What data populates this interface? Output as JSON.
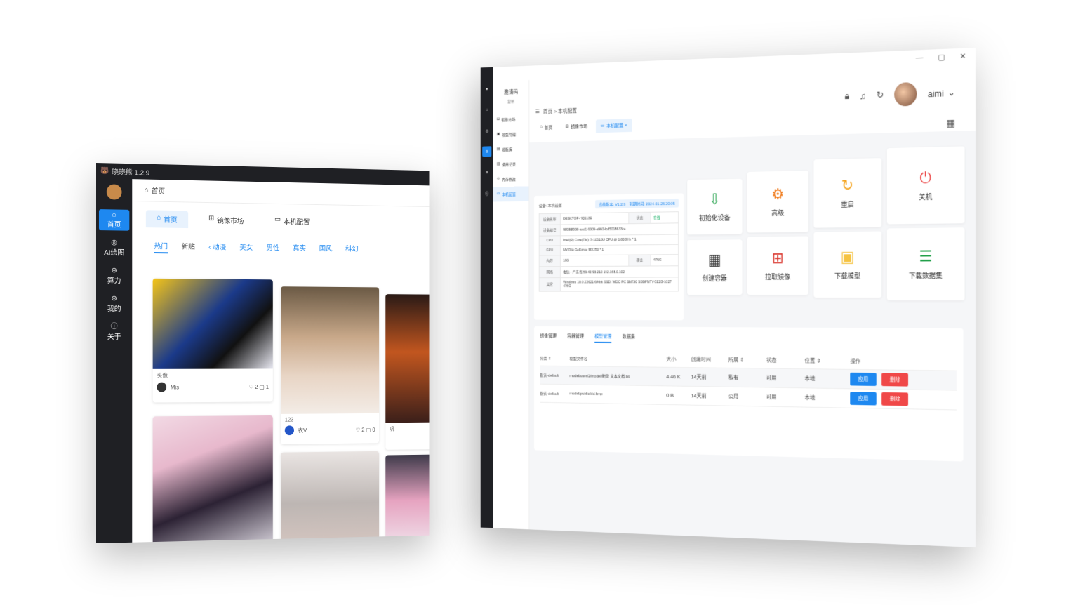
{
  "back_window": {
    "title": "晓晓熊 1.2.9",
    "nav": [
      {
        "icon": "⌂",
        "label": "首页",
        "active": true
      },
      {
        "icon": "◎",
        "label": "AI绘图"
      },
      {
        "icon": "⊕",
        "label": "算力"
      },
      {
        "icon": "⊛",
        "label": "我的"
      },
      {
        "icon": "ⓘ",
        "label": "关于"
      }
    ],
    "breadcrumb": "首页",
    "tabs": [
      {
        "icon": "⌂",
        "label": "首页",
        "active": true
      },
      {
        "icon": "⊞",
        "label": "镜像市场"
      },
      {
        "icon": "▭",
        "label": "本机配置"
      }
    ],
    "categories": [
      {
        "label": "热门",
        "state": "active"
      },
      {
        "label": "新贴"
      },
      {
        "label": "‹ 动漫",
        "state": "blue"
      },
      {
        "label": "美女",
        "state": "blue"
      },
      {
        "label": "男性",
        "state": "blue"
      },
      {
        "label": "真实",
        "state": "blue"
      },
      {
        "label": "国风",
        "state": "blue"
      },
      {
        "label": "科幻",
        "state": "blue"
      }
    ],
    "cards": [
      {
        "caption": "头像",
        "author": "Mis",
        "stats": "♡ 2  ▢ 1"
      },
      {
        "caption": "123",
        "author": "衣V",
        "stats": "♡ 2  ▢ 0"
      },
      {
        "caption": "巩",
        "author": "",
        "stats": ""
      }
    ]
  },
  "front_window": {
    "user": "aimi",
    "submenu_title": "邀请码",
    "submenu_sub": "复制",
    "submenu": [
      {
        "label": "镜像市场"
      },
      {
        "label": "模型管理"
      },
      {
        "label": "模版库"
      },
      {
        "label": "使用记录"
      },
      {
        "label": "内存修改"
      },
      {
        "label": "本机配置",
        "active": true
      }
    ],
    "breadcrumb": "首页 > 本机配置",
    "tabs": [
      {
        "label": "首页"
      },
      {
        "label": "镜像市场"
      },
      {
        "label": "本机配置 ×",
        "active": true
      }
    ],
    "device": {
      "title": "设备: 本机设置",
      "version": "当前版本: V1.2.9",
      "expire": "到期时间: 2024-01-26 20:05",
      "rows": [
        {
          "k": "设备名称",
          "v": "DESKTOP-HQ113E",
          "k2": "状态",
          "v2": "在线"
        },
        {
          "k": "设备编号",
          "v": "9898f8998-aed1-9909-a960-fcd5018633ce"
        },
        {
          "k": "CPU",
          "v": "Intel(R) Core(TM) i7-10510U CPU @ 1.80GHz * 1"
        },
        {
          "k": "GPU",
          "v": "NVIDIA GeForce MX250 * 1"
        },
        {
          "k": "内存",
          "v": "16G",
          "k2": "硬盘",
          "v2": "476G"
        },
        {
          "k": "网络",
          "v": "电信 - 广东省 59.42.93.210 192.168.0.102"
        },
        {
          "k": "其它",
          "v": "Windows 10.0.22621 64-bit  SSD: WDC PC SN730 SDBPNTY-512G-1027 476G"
        }
      ]
    },
    "actions": [
      {
        "label": "初始化设备",
        "icon": "⇩",
        "color": "#22a04a"
      },
      {
        "label": "高级",
        "icon": "⚙",
        "color": "#f07a1a"
      },
      {
        "label": "重启",
        "icon": "↻",
        "color": "#f5a623"
      },
      {
        "label": "关机",
        "icon": "⏻",
        "color": "#ea3a3a"
      },
      {
        "label": "创建容器",
        "icon": "▦",
        "color": "#333333"
      },
      {
        "label": "拉取镜像",
        "icon": "⊞",
        "color": "#d9342b"
      },
      {
        "label": "下载模型",
        "icon": "▣",
        "color": "#f5c342"
      },
      {
        "label": "下载数据集",
        "icon": "☰",
        "color": "#22a04a"
      }
    ],
    "model_tabs": [
      {
        "label": "镜像管理"
      },
      {
        "label": "容器管理"
      },
      {
        "label": "模型管理",
        "active": true
      },
      {
        "label": "数据集"
      }
    ],
    "table_headers": [
      "分类 ⇕",
      "模型文件名",
      "大小",
      "创建时间",
      "所属 ⇕",
      "状态",
      "位置 ⇕",
      "操作"
    ],
    "table_rows": [
      {
        "cat": "默认-default",
        "file": "model/user/2/model/新建 文本文档.txt",
        "size": "4.46 K",
        "time": "14天前",
        "owner": "私有",
        "status": "可用",
        "loc": "本地"
      },
      {
        "cat": "默认-default",
        "file": "model/public/dd.bmp",
        "size": "0 B",
        "time": "14天前",
        "owner": "公用",
        "status": "可用",
        "loc": "本地"
      }
    ],
    "btn_apply": "应用",
    "btn_delete": "删除"
  }
}
